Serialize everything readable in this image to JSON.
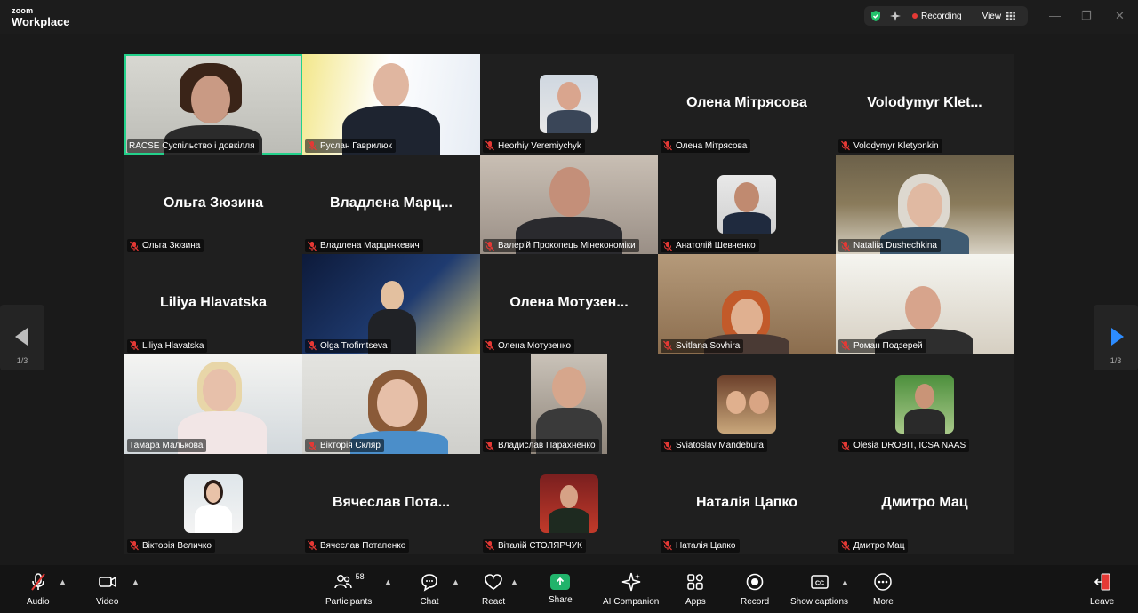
{
  "titlebar": {
    "brand_top": "zoom",
    "brand_bottom": "Workplace",
    "recording_label": "Recording",
    "view_label": "View"
  },
  "nav": {
    "left_page": "1/3",
    "right_page": "1/3"
  },
  "tiles": [
    {
      "display": "",
      "name": "RACSE Суспільство і довкілля",
      "muted": false
    },
    {
      "display": "",
      "name": "Руслан Гаврилюк",
      "muted": true
    },
    {
      "display": "",
      "name": "Heorhiy Veremiychyk",
      "muted": true
    },
    {
      "display": "Олена Мітрясова",
      "name": "Олена Мітрясова",
      "muted": true
    },
    {
      "display": "Volodymyr  Klet...",
      "name": "Volodymyr Kletyonkin",
      "muted": true
    },
    {
      "display": "Ольга Зюзина",
      "name": "Ольга Зюзина",
      "muted": true
    },
    {
      "display": "Владлена  Марц...",
      "name": "Владлена Марцинкевич",
      "muted": true
    },
    {
      "display": "",
      "name": "Валерій Прокопець Мінекономіки",
      "muted": true
    },
    {
      "display": "",
      "name": "Анатолій Шевченко",
      "muted": true
    },
    {
      "display": "",
      "name": "Nataliia Dushechkina",
      "muted": true
    },
    {
      "display": "Liliya Hlavatska",
      "name": "Liliya Hlavatska",
      "muted": true
    },
    {
      "display": "",
      "name": "Olga Trofimtseva",
      "muted": true
    },
    {
      "display": "Олена  Мотузен...",
      "name": "Олена Мотузенко",
      "muted": true
    },
    {
      "display": "",
      "name": "Svitlana Sovhira",
      "muted": true
    },
    {
      "display": "",
      "name": "Роман Подзерей",
      "muted": true
    },
    {
      "display": "",
      "name": "Тамара Малькова",
      "muted": false
    },
    {
      "display": "",
      "name": "Вікторія Скляр",
      "muted": true
    },
    {
      "display": "",
      "name": "Владислав Парахненко",
      "muted": true
    },
    {
      "display": "",
      "name": "Sviatoslav Mandebura",
      "muted": true
    },
    {
      "display": "",
      "name": "Olesia DROBIT, ICSA NAAS",
      "muted": true
    },
    {
      "display": "",
      "name": "Вікторія Величко",
      "muted": true
    },
    {
      "display": "Вячеслав  Пота...",
      "name": "Вячеслав Потапенко",
      "muted": true
    },
    {
      "display": "",
      "name": "Віталій СТОЛЯРЧУК",
      "muted": true
    },
    {
      "display": "Наталія Цапко",
      "name": "Наталія Цапко",
      "muted": true
    },
    {
      "display": "Дмитро Мац",
      "name": "Дмитро Мац",
      "muted": true
    }
  ],
  "toolbar": {
    "audio": "Audio",
    "video": "Video",
    "participants": "Participants",
    "participants_count": "58",
    "chat": "Chat",
    "react": "React",
    "share": "Share",
    "ai_companion": "AI Companion",
    "apps": "Apps",
    "record": "Record",
    "show_captions": "Show captions",
    "more": "More",
    "leave": "Leave"
  },
  "colors": {
    "accent": "#2d8cff",
    "active_speaker": "#23d18b",
    "share": "#21b36b",
    "mute_red": "#e53935",
    "leave": "#e53935"
  }
}
